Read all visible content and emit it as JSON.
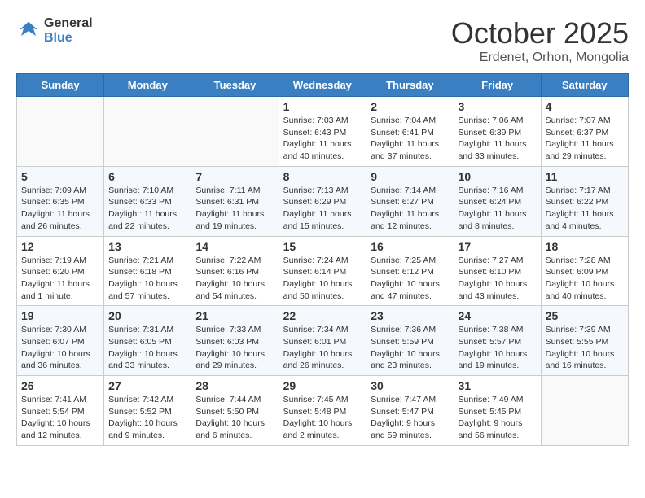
{
  "header": {
    "logo_general": "General",
    "logo_blue": "Blue",
    "month_title": "October 2025",
    "subtitle": "Erdenet, Orhon, Mongolia"
  },
  "weekdays": [
    "Sunday",
    "Monday",
    "Tuesday",
    "Wednesday",
    "Thursday",
    "Friday",
    "Saturday"
  ],
  "weeks": [
    [
      {
        "day": "",
        "info": ""
      },
      {
        "day": "",
        "info": ""
      },
      {
        "day": "",
        "info": ""
      },
      {
        "day": "1",
        "info": "Sunrise: 7:03 AM\nSunset: 6:43 PM\nDaylight: 11 hours\nand 40 minutes."
      },
      {
        "day": "2",
        "info": "Sunrise: 7:04 AM\nSunset: 6:41 PM\nDaylight: 11 hours\nand 37 minutes."
      },
      {
        "day": "3",
        "info": "Sunrise: 7:06 AM\nSunset: 6:39 PM\nDaylight: 11 hours\nand 33 minutes."
      },
      {
        "day": "4",
        "info": "Sunrise: 7:07 AM\nSunset: 6:37 PM\nDaylight: 11 hours\nand 29 minutes."
      }
    ],
    [
      {
        "day": "5",
        "info": "Sunrise: 7:09 AM\nSunset: 6:35 PM\nDaylight: 11 hours\nand 26 minutes."
      },
      {
        "day": "6",
        "info": "Sunrise: 7:10 AM\nSunset: 6:33 PM\nDaylight: 11 hours\nand 22 minutes."
      },
      {
        "day": "7",
        "info": "Sunrise: 7:11 AM\nSunset: 6:31 PM\nDaylight: 11 hours\nand 19 minutes."
      },
      {
        "day": "8",
        "info": "Sunrise: 7:13 AM\nSunset: 6:29 PM\nDaylight: 11 hours\nand 15 minutes."
      },
      {
        "day": "9",
        "info": "Sunrise: 7:14 AM\nSunset: 6:27 PM\nDaylight: 11 hours\nand 12 minutes."
      },
      {
        "day": "10",
        "info": "Sunrise: 7:16 AM\nSunset: 6:24 PM\nDaylight: 11 hours\nand 8 minutes."
      },
      {
        "day": "11",
        "info": "Sunrise: 7:17 AM\nSunset: 6:22 PM\nDaylight: 11 hours\nand 4 minutes."
      }
    ],
    [
      {
        "day": "12",
        "info": "Sunrise: 7:19 AM\nSunset: 6:20 PM\nDaylight: 11 hours\nand 1 minute."
      },
      {
        "day": "13",
        "info": "Sunrise: 7:21 AM\nSunset: 6:18 PM\nDaylight: 10 hours\nand 57 minutes."
      },
      {
        "day": "14",
        "info": "Sunrise: 7:22 AM\nSunset: 6:16 PM\nDaylight: 10 hours\nand 54 minutes."
      },
      {
        "day": "15",
        "info": "Sunrise: 7:24 AM\nSunset: 6:14 PM\nDaylight: 10 hours\nand 50 minutes."
      },
      {
        "day": "16",
        "info": "Sunrise: 7:25 AM\nSunset: 6:12 PM\nDaylight: 10 hours\nand 47 minutes."
      },
      {
        "day": "17",
        "info": "Sunrise: 7:27 AM\nSunset: 6:10 PM\nDaylight: 10 hours\nand 43 minutes."
      },
      {
        "day": "18",
        "info": "Sunrise: 7:28 AM\nSunset: 6:09 PM\nDaylight: 10 hours\nand 40 minutes."
      }
    ],
    [
      {
        "day": "19",
        "info": "Sunrise: 7:30 AM\nSunset: 6:07 PM\nDaylight: 10 hours\nand 36 minutes."
      },
      {
        "day": "20",
        "info": "Sunrise: 7:31 AM\nSunset: 6:05 PM\nDaylight: 10 hours\nand 33 minutes."
      },
      {
        "day": "21",
        "info": "Sunrise: 7:33 AM\nSunset: 6:03 PM\nDaylight: 10 hours\nand 29 minutes."
      },
      {
        "day": "22",
        "info": "Sunrise: 7:34 AM\nSunset: 6:01 PM\nDaylight: 10 hours\nand 26 minutes."
      },
      {
        "day": "23",
        "info": "Sunrise: 7:36 AM\nSunset: 5:59 PM\nDaylight: 10 hours\nand 23 minutes."
      },
      {
        "day": "24",
        "info": "Sunrise: 7:38 AM\nSunset: 5:57 PM\nDaylight: 10 hours\nand 19 minutes."
      },
      {
        "day": "25",
        "info": "Sunrise: 7:39 AM\nSunset: 5:55 PM\nDaylight: 10 hours\nand 16 minutes."
      }
    ],
    [
      {
        "day": "26",
        "info": "Sunrise: 7:41 AM\nSunset: 5:54 PM\nDaylight: 10 hours\nand 12 minutes."
      },
      {
        "day": "27",
        "info": "Sunrise: 7:42 AM\nSunset: 5:52 PM\nDaylight: 10 hours\nand 9 minutes."
      },
      {
        "day": "28",
        "info": "Sunrise: 7:44 AM\nSunset: 5:50 PM\nDaylight: 10 hours\nand 6 minutes."
      },
      {
        "day": "29",
        "info": "Sunrise: 7:45 AM\nSunset: 5:48 PM\nDaylight: 10 hours\nand 2 minutes."
      },
      {
        "day": "30",
        "info": "Sunrise: 7:47 AM\nSunset: 5:47 PM\nDaylight: 9 hours\nand 59 minutes."
      },
      {
        "day": "31",
        "info": "Sunrise: 7:49 AM\nSunset: 5:45 PM\nDaylight: 9 hours\nand 56 minutes."
      },
      {
        "day": "",
        "info": ""
      }
    ]
  ]
}
